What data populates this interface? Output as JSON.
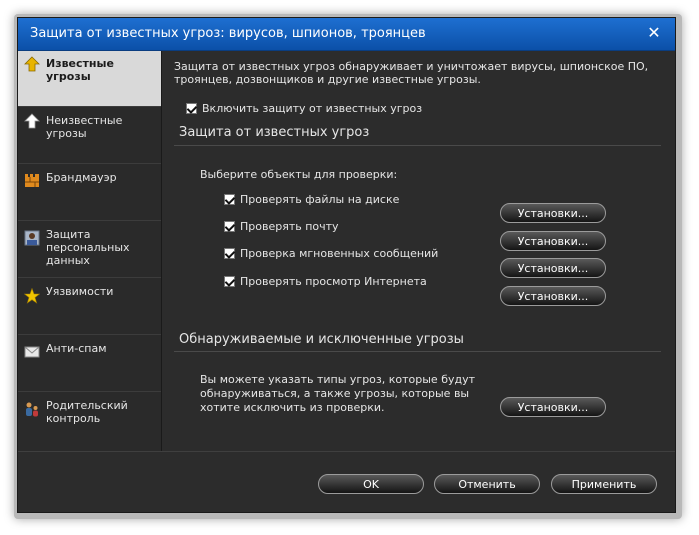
{
  "window": {
    "title": "Защита от известных угроз: вирусов, шпионов, троянцев",
    "close_glyph": "✕"
  },
  "sidebar": {
    "items": [
      {
        "label": "Известные\nугрозы",
        "icon": "arrow-up-icon",
        "active": true
      },
      {
        "label": "Неизвестные\nугрозы",
        "icon": "arrow-up-icon"
      },
      {
        "label": "Брандмауэр",
        "icon": "firewall-icon"
      },
      {
        "label": "Защита\nперсональных\nданных",
        "icon": "personal-data-icon"
      },
      {
        "label": "Уязвимости",
        "icon": "star-icon"
      },
      {
        "label": "Анти-спам",
        "icon": "envelope-icon"
      },
      {
        "label": "Родительский\nконтроль",
        "icon": "parental-control-icon"
      }
    ]
  },
  "main": {
    "intro": "Защита от известных угроз обнаруживает и уничтожает вирусы, шпионское ПО, троянцев, дозвонщиков и другие известные угрозы.",
    "enable_label": "Включить защиту от известных угроз",
    "section1_title": "Защита от известных угроз",
    "select_prompt": "Выберите объекты для проверки:",
    "checks": [
      {
        "label": "Проверять файлы на диске",
        "button": "Установки..."
      },
      {
        "label": "Проверять почту",
        "button": "Установки..."
      },
      {
        "label": "Проверка мгновенных сообщений",
        "button": "Установки..."
      },
      {
        "label": "Проверять просмотр Интернета",
        "button": "Установки..."
      }
    ],
    "section2_title": "Обнаруживаемые и исключенные угрозы",
    "section2_text": "Вы можете указать типы угроз, которые будут обнаруживаться, а также угрозы, которые вы хотите исключить из проверки.",
    "section2_button": "Установки..."
  },
  "footer": {
    "ok": "OK",
    "cancel": "Отменить",
    "apply": "Применить"
  },
  "colors": {
    "titlebar": "#1464c8",
    "background": "#2c2c2c",
    "active_nav": "#d9d9d9"
  }
}
